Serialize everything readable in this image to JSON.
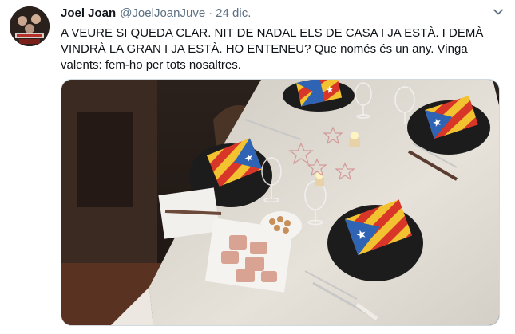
{
  "tweet": {
    "author_name": "Joel Joan",
    "author_handle": "@JoelJoanJuve",
    "separator": "·",
    "date": "24 dic.",
    "text": "A VEURE SI QUEDA CLAR. NIT DE NADAL ELS DE CASA I JA ESTÀ. I DEMÀ VINDRÀ LA GRAN I JA ESTÀ. HO ENTENEU? Que només és un any. Vinga valents: fem-ho per tots nosaltres."
  },
  "icons": {
    "more_menu": "chevron-down-icon"
  },
  "colors": {
    "name": "#0f1419",
    "secondary_text": "#5b7083",
    "media_border": "#cfd9de",
    "flag_yellow": "#f2c230",
    "flag_red": "#d9362a",
    "flag_blue": "#2f63b4"
  }
}
